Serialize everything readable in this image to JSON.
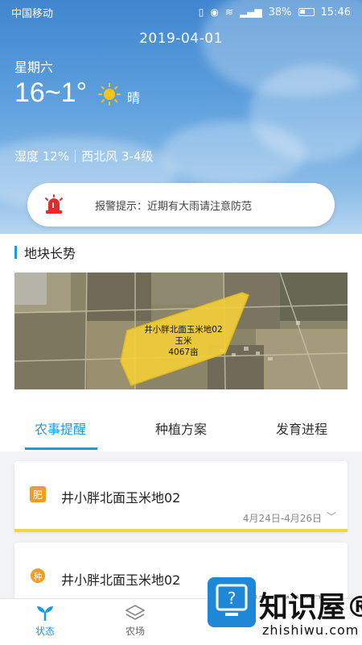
{
  "status_bar": {
    "carrier": "中国移动",
    "battery": "38%",
    "time": "15:46"
  },
  "weather": {
    "date": "2019-04-01",
    "weekday": "星期六",
    "temperature": "16~1°",
    "condition": "晴",
    "humidity_wind": "湿度 12%｜西北风 3-4级"
  },
  "alarm": {
    "text": "报警提示：近期有大雨请注意防范"
  },
  "section": {
    "title": "地块长势"
  },
  "map": {
    "plot_name": "井小胖北面玉米地02",
    "crop": "玉米",
    "area": "4067亩",
    "plot_color": "#f4cf3a"
  },
  "tabs": [
    {
      "label": "农事提醒",
      "active": true
    },
    {
      "label": "种植方案",
      "active": false
    },
    {
      "label": "发育进程",
      "active": false
    }
  ],
  "cards": [
    {
      "badge": "肥",
      "title": "井小胖北面玉米地02",
      "date": "4月24日-4月26日",
      "badge_color": "#f39a2b"
    },
    {
      "badge": "种",
      "title": "井小胖北面玉米地02",
      "date": "4月27日-4月29日",
      "badge_color": "#f39a2b"
    }
  ],
  "bottom_nav": [
    {
      "label": "状态",
      "icon": "sprout-icon",
      "active": true
    },
    {
      "label": "农场",
      "icon": "layers-icon",
      "active": false
    },
    {
      "label": "",
      "icon": "",
      "active": false
    },
    {
      "label": "",
      "icon": "",
      "active": false
    }
  ],
  "watermark": {
    "logo": "知识屋®",
    "site": "zhishiwu.com"
  },
  "colors": {
    "accent": "#1a9be6",
    "alarm_red": "#e32b2b",
    "highlight_yellow": "#f5d53f"
  }
}
